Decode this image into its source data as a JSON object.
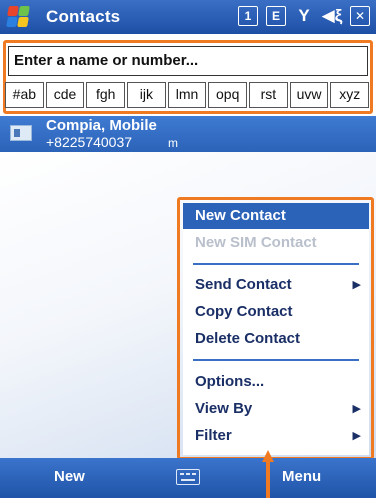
{
  "titlebar": {
    "title": "Contacts",
    "icons": [
      "calendar-icon",
      "message-icon",
      "signal-icon",
      "speaker-icon",
      "close-icon"
    ],
    "icon_glyphs": [
      "1",
      "E",
      "Y",
      "◀ξ",
      "✕"
    ]
  },
  "search": {
    "value": "Enter a name or number..."
  },
  "alpha_tabs": [
    "#ab",
    "cde",
    "fgh",
    "ijk",
    "lmn",
    "opq",
    "rst",
    "uvw",
    "xyz"
  ],
  "contact": {
    "name": "Compia, Mobile",
    "number": "+8225740037",
    "suffix": "m"
  },
  "menu": {
    "items": [
      {
        "label": "New Contact",
        "state": "selected"
      },
      {
        "label": "New SIM Contact",
        "state": "disabled"
      },
      {
        "label": "Send Contact",
        "submenu": true
      },
      {
        "label": "Copy Contact"
      },
      {
        "label": "Delete Contact"
      },
      {
        "label": "Options..."
      },
      {
        "label": "View By",
        "submenu": true
      },
      {
        "label": "Filter",
        "submenu": true
      }
    ]
  },
  "softkeys": {
    "left": "New",
    "right": "Menu"
  },
  "colors": {
    "accent": "#2b63b8",
    "highlight": "#f07a21",
    "menu_text": "#1a2f66",
    "disabled": "#b9c0cc"
  }
}
